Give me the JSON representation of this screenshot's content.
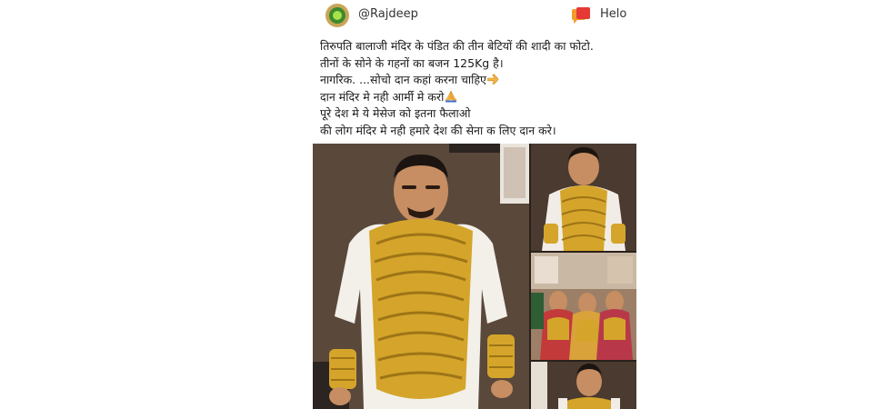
{
  "post": {
    "username": "@Rajdeep",
    "app_name": "Helo",
    "text_lines": [
      "तिरुपति बालाजी मंदिर के पंडित की तीन बेटियों की शादी का फोटो.",
      "तीनों के सोने के गहनों  का बजन  125Kg है।",
      "नागरिक. ...सोचो दान कहां करना चाहिए",
      "दान मंदिर मे नही आर्मी मे करो",
      "पूरे देश मे ये मेसेज को इतना फैलाओ",
      "की लोग मंदिर मे नही हमारे देश की सेना क लिए दान करे।"
    ],
    "emojis": {
      "line3": "👉",
      "line4": "🙏"
    }
  },
  "icons": {
    "avatar": "profile-avatar-icon",
    "app": "helo-chat-icon"
  },
  "colors": {
    "app_icon_orange": "#f39a2a",
    "app_icon_red": "#e53935",
    "avatar_ring": "#c9a557",
    "avatar_fill": "#3c8a2e",
    "gold": "#d4a52a"
  }
}
